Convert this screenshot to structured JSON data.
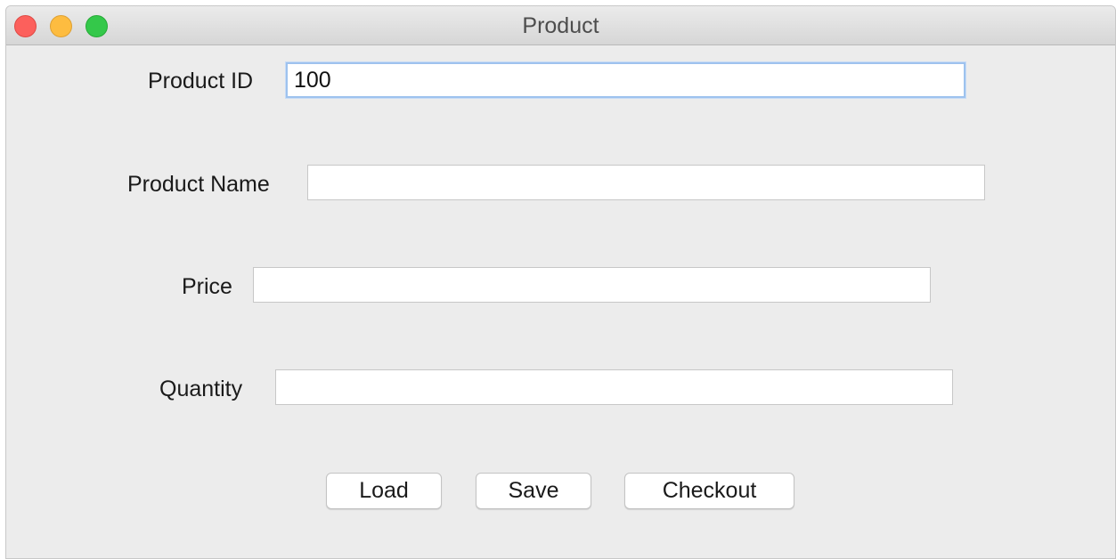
{
  "window": {
    "title": "Product"
  },
  "form": {
    "product_id": {
      "label": "Product ID",
      "value": "100",
      "placeholder": ""
    },
    "product_name": {
      "label": "Product Name",
      "value": "",
      "placeholder": ""
    },
    "price": {
      "label": "Price",
      "value": "",
      "placeholder": ""
    },
    "quantity": {
      "label": "Quantity",
      "value": "",
      "placeholder": ""
    }
  },
  "buttons": {
    "load": "Load",
    "save": "Save",
    "checkout": "Checkout"
  },
  "colors": {
    "close": "#fc605c",
    "minimize": "#fdbc40",
    "maximize": "#34c84a",
    "focus_ring": "#9ec2ee"
  }
}
